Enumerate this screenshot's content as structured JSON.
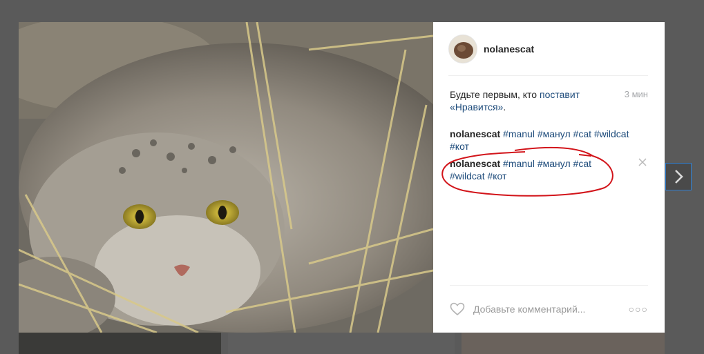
{
  "post": {
    "username": "nolanescat",
    "likes_prefix": "Будьте первым, кто ",
    "likes_link": "поставит «Нравится»",
    "likes_suffix": ".",
    "time": "3 мин"
  },
  "comments": [
    {
      "author": "nolanescat",
      "tags": [
        "#manul",
        "#манул",
        "#cat",
        "#wildcat",
        "#кот"
      ]
    },
    {
      "author": "nolanescat",
      "tags": [
        "#manul",
        "#манул",
        "#cat",
        "#wildcat",
        "#кот"
      ]
    }
  ],
  "footer": {
    "comment_placeholder": "Добавьте комментарий...",
    "more_label": "○○○"
  },
  "icons": {
    "like": "heart-icon",
    "next": "chevron-right-icon",
    "delete": "close-icon"
  },
  "colors": {
    "link": "#1c4a7a",
    "annotation": "#d2141a",
    "next_border": "#2e7fd3"
  }
}
